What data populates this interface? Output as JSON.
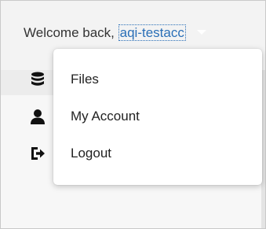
{
  "header": {
    "welcome_text": "Welcome back,",
    "username": "aqi-testacc"
  },
  "menu": {
    "items": [
      {
        "label": "Files",
        "icon": "database-icon"
      },
      {
        "label": "My Account",
        "icon": "user-icon"
      },
      {
        "label": "Logout",
        "icon": "sign-out-icon"
      }
    ]
  },
  "colors": {
    "link": "#2a6fb7",
    "text": "#333333",
    "icon": "#111111"
  }
}
